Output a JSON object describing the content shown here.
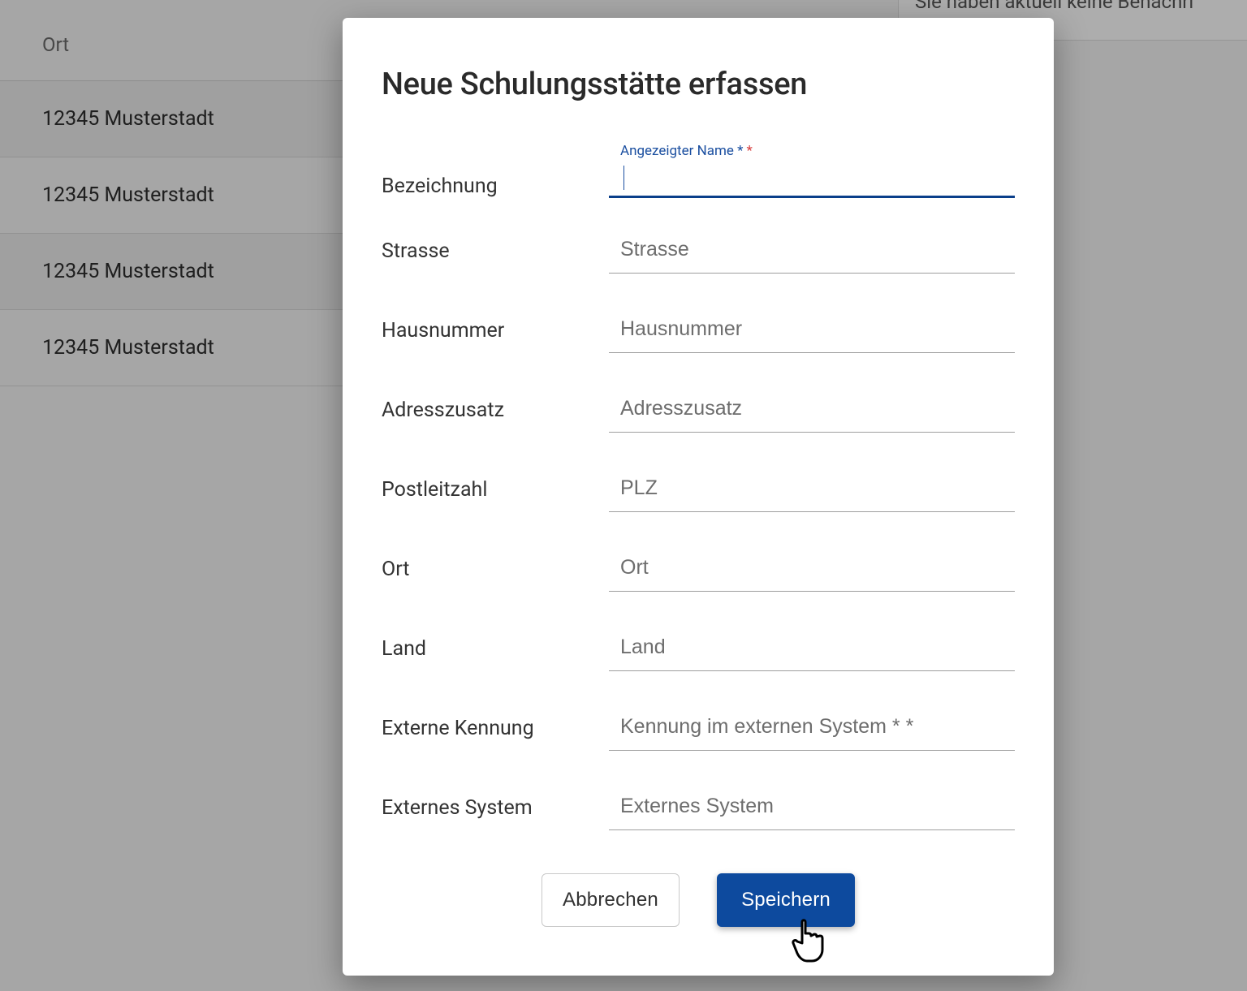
{
  "background": {
    "column_header": "Ort",
    "rows": [
      "12345 Musterstadt",
      "12345 Musterstadt",
      "12345 Musterstadt",
      "12345 Musterstadt"
    ],
    "side_text": "Sie haben aktuell keine Benachri"
  },
  "modal": {
    "title": "Neue Schulungsstätte erfassen",
    "fields": {
      "bezeichnung": {
        "label": "Bezeichnung",
        "floating_label": "Angezeigter Name *",
        "required_mark": "*",
        "value": ""
      },
      "strasse": {
        "label": "Strasse",
        "placeholder": "Strasse",
        "value": ""
      },
      "hausnummer": {
        "label": "Hausnummer",
        "placeholder": "Hausnummer",
        "value": ""
      },
      "adresszusatz": {
        "label": "Adresszusatz",
        "placeholder": "Adresszusatz",
        "value": ""
      },
      "postleitzahl": {
        "label": "Postleitzahl",
        "placeholder": "PLZ",
        "value": ""
      },
      "ort": {
        "label": "Ort",
        "placeholder": "Ort",
        "value": ""
      },
      "land": {
        "label": "Land",
        "placeholder": "Land",
        "value": ""
      },
      "externe_kennung": {
        "label": "Externe Kennung",
        "placeholder": "Kennung im externen System * *",
        "value": ""
      },
      "externes_system": {
        "label": "Externes System",
        "placeholder": "Externes System",
        "value": ""
      }
    },
    "buttons": {
      "cancel": "Abbrechen",
      "save": "Speichern"
    }
  }
}
